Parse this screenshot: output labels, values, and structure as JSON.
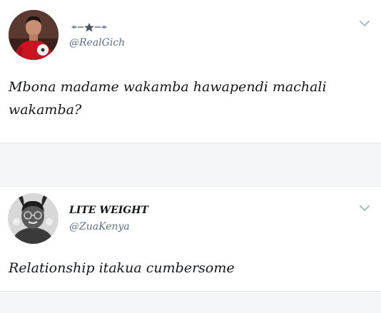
{
  "tweets": [
    {
      "display_name": "",
      "handle": "@RealGich",
      "text": "Mbona madame wakamba hawapendi machali wakamba?",
      "avatar": "football-player-avatar",
      "name_icon": "star-ornament-icon",
      "menu_icon": "chevron-down-icon"
    },
    {
      "display_name": "LITE WEIGHT",
      "handle": "@ZuaKenya",
      "text": "Relationship itakua cumbersome",
      "avatar": "person-bunny-ears-avatar",
      "menu_icon": "chevron-down-icon"
    }
  ],
  "colors": {
    "text": "#14171a",
    "handle": "#5b7083",
    "separator_band": "#f4f5f6",
    "chevron": "#b0b8c0"
  }
}
